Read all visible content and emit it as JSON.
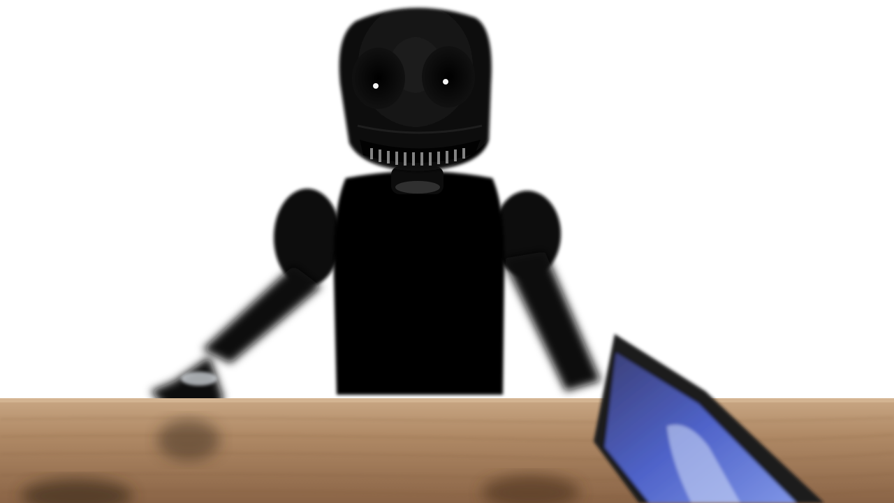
{
  "scene": {
    "background_color": "#ffffff",
    "figure_color": "#080808",
    "eye_glint_color": "#f5f5f5",
    "desk_color": "#b08a66",
    "tablet_frame_color": "#1a1a1e",
    "tablet_screen_color": "#5a6fd0"
  },
  "icons": {
    "figure": "shadow-animatronic-figure",
    "desk": "wooden-desk",
    "tablet": "monitor-tablet"
  }
}
